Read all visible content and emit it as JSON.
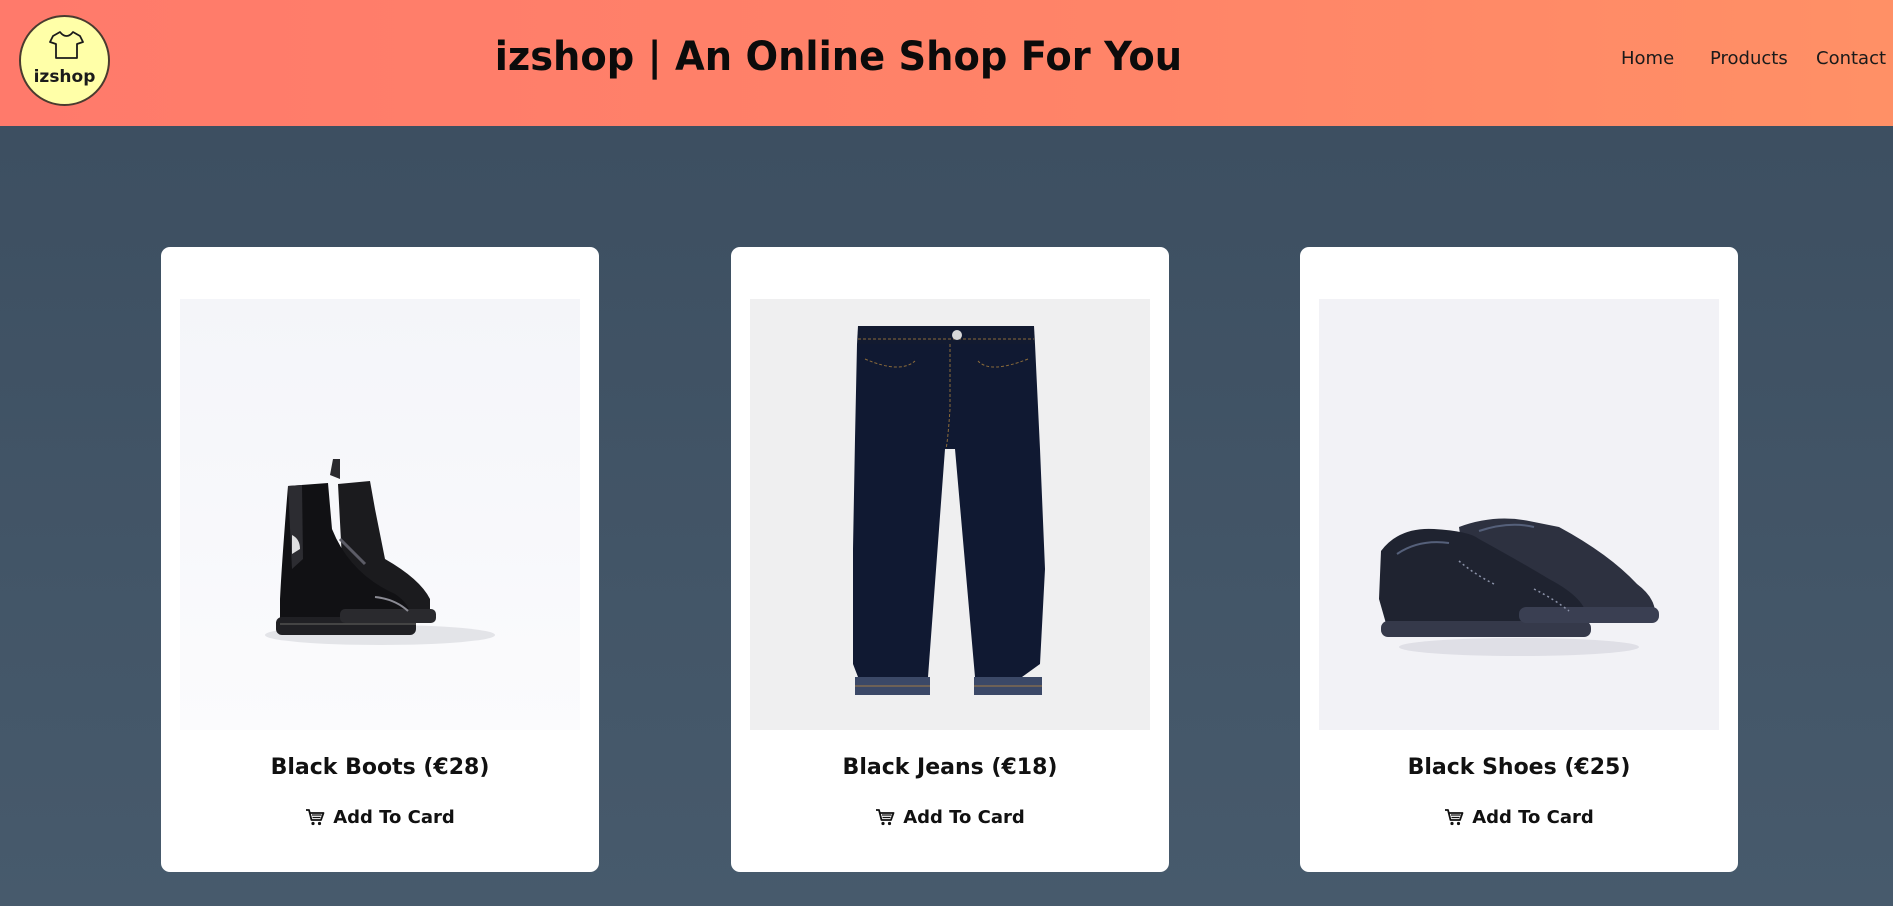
{
  "header": {
    "logo_text": "izshop",
    "logo_icon": "tshirt-icon",
    "title": "izshop | An Online Shop For You",
    "nav": [
      {
        "label": "Home"
      },
      {
        "label": "Products"
      },
      {
        "label": "Contact"
      }
    ]
  },
  "products": [
    {
      "name": "Black Boots (€28)",
      "button": "Add To Card",
      "image": "black-boots-photo"
    },
    {
      "name": "Black Jeans (€18)",
      "button": "Add To Card",
      "image": "black-jeans-photo"
    },
    {
      "name": "Black Shoes (€25)",
      "button": "Add To Card",
      "image": "black-shoes-photo"
    }
  ],
  "colors": {
    "header_gradient_start": "#ff7a6b",
    "header_gradient_end": "#ff9066",
    "page_background": "#3f5163",
    "logo_background": "#ffffa8",
    "card_background": "#ffffff"
  }
}
